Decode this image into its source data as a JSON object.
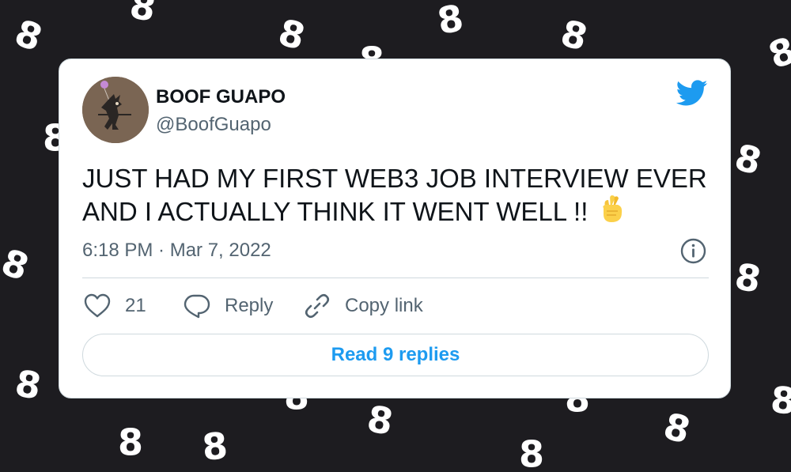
{
  "colors": {
    "background": "#1d1c20",
    "card": "#ffffff",
    "text_primary": "#0f1419",
    "text_secondary": "#536471",
    "accent": "#1d9bf0",
    "border": "#cfd9de"
  },
  "background": {
    "pattern_icon": "squiggle-eight-icon",
    "pattern_glyph": "8"
  },
  "tweet": {
    "author": {
      "display_name": "BOOF GUAPO",
      "handle": "@BoofGuapo",
      "avatar_icon": "avatar-image"
    },
    "text": "JUST HAD MY FIRST WEB3 JOB INTERVIEW EVER AND I ACTUALLY THINK IT WENT WELL !!",
    "emoji": "🤞",
    "timestamp": "6:18 PM · Mar 7, 2022",
    "platform_icon": "twitter-bird-icon",
    "info_icon": "info-icon"
  },
  "actions": {
    "like": {
      "icon": "heart-icon",
      "count": "21"
    },
    "reply": {
      "icon": "reply-bubble-icon",
      "label": "Reply"
    },
    "copy_link": {
      "icon": "link-icon",
      "label": "Copy link"
    }
  },
  "read_replies": {
    "label": "Read 9 replies"
  }
}
